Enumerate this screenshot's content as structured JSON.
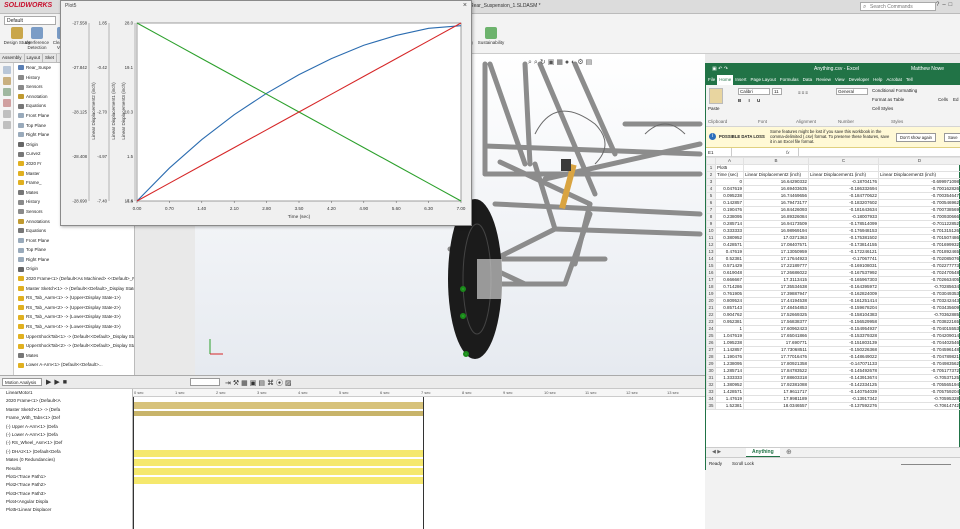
{
  "app": {
    "name": "SOLIDWORKS",
    "doc_title": "Rear_Suspension_1.SLDASM *",
    "search_placeholder": "Search Commands",
    "config": "Default"
  },
  "commands": [
    "Design Study",
    "Interference Detection",
    "Clearance Verific",
    "Hole Alignment",
    "Measure",
    "Mass Properties",
    "Costing",
    "Sustainability"
  ],
  "cm_tabs": [
    "Assembly",
    "Layout",
    "Sket"
  ],
  "tree_top": [
    {
      "label": "Rear_Suspe",
      "color": "#5a7fb5"
    },
    {
      "label": "History",
      "color": "#8a8a8a"
    },
    {
      "label": "Sensors",
      "color": "#8a8a8a"
    },
    {
      "label": "Annotation",
      "color": "#c09a30"
    },
    {
      "label": "Equations",
      "color": "#777"
    },
    {
      "label": "Front Plane",
      "color": "#9ab"
    },
    {
      "label": "Top Plane",
      "color": "#9ab"
    },
    {
      "label": "Right Plane",
      "color": "#9ab"
    },
    {
      "label": "Origin",
      "color": "#666"
    },
    {
      "label": "Curve2",
      "color": "#777"
    },
    {
      "label": "2020 Fr",
      "color": "#e0b020"
    },
    {
      "label": "Master",
      "color": "#e0b020"
    },
    {
      "label": "Frame_",
      "color": "#e0b020"
    },
    {
      "label": "Mates",
      "color": "#777"
    },
    {
      "label": "History",
      "color": "#8a8a8a"
    },
    {
      "label": "Sensors",
      "color": "#8a8a8a"
    },
    {
      "label": "Annotations",
      "color": "#c09a30"
    },
    {
      "label": "Equations",
      "color": "#777"
    },
    {
      "label": "Front Plane",
      "color": "#9ab"
    },
    {
      "label": "Top Plane",
      "color": "#9ab"
    },
    {
      "label": "Right Plane",
      "color": "#9ab"
    },
    {
      "label": "Origin",
      "color": "#666"
    },
    {
      "label": "2020 Frame<1> (Default<As Machined> <<Default>_PhotoWork",
      "color": "#e0b020"
    },
    {
      "label": "Master Sketch<1> -> (Default<<Default>_Display State 1>)",
      "color": "#e0b020"
    },
    {
      "label": "RS_Tab_Aarm<1> -> (Upper<Display State-1>)",
      "color": "#e0b020"
    },
    {
      "label": "RS_Tab_Aarm<2> -> (Upper<Display State-2>)",
      "color": "#e0b020"
    },
    {
      "label": "RS_Tab_Aarm<3> -> (Lower<Display State-3>)",
      "color": "#e0b020"
    },
    {
      "label": "RS_Tab_Aarm<4> -> (Lower<Display State-3>)",
      "color": "#e0b020"
    },
    {
      "label": "UpperShockTab<1> -> (Default<<Default>_Display State 1>)",
      "color": "#e0b020"
    },
    {
      "label": "UpperShockTab<2> -> (Default<<Default>_Display State 1>)",
      "color": "#e0b020"
    },
    {
      "label": "Mates",
      "color": "#777"
    },
    {
      "label": "Lower A-Arm<1> (Default<<Default>...",
      "color": "#e0b020"
    }
  ],
  "plot": {
    "window_title": "Plot5",
    "close": "×"
  },
  "chart_data": {
    "type": "line",
    "title": "",
    "xlabel": "Time (sec)",
    "ylabel_left1": "Linear Displacement2 (inch)",
    "ylabel_left2": "Linear Displacement1 (inch)",
    "ylabel_right": "Linear Displacement3 (inch)",
    "x": [
      0.0,
      0.7,
      1.4,
      2.1,
      2.8,
      3.5,
      4.2,
      4.9,
      5.6,
      6.3,
      7.0
    ],
    "xlim": [
      0.0,
      7.0
    ],
    "xticks": [
      "0.00",
      "0.70",
      "1.40",
      "2.10",
      "2.80",
      "3.50",
      "4.20",
      "4.90",
      "5.60",
      "6.30",
      "7.00"
    ],
    "axis1_ticks": [
      "-27.558",
      "-27.842",
      "-28.125",
      "-28.408",
      "-28.690"
    ],
    "axis2_ticks": [
      "1.85",
      "-0.42",
      "-2.70",
      "-4.97",
      "-7.40"
    ],
    "axis3_ticks": [
      "28.0",
      "19.1",
      "10.3",
      "1.5",
      "-7.4"
    ],
    "axis4_ticks": [
      "16.6"
    ],
    "ylim": [
      0,
      1
    ],
    "series": [
      {
        "color": "#2b6cb0",
        "values": [
          0.0,
          0.185,
          0.345,
          0.485,
          0.605,
          0.71,
          0.8,
          0.875,
          0.93,
          0.97,
          0.985
        ]
      },
      {
        "color": "#2ca02c",
        "values": [
          1.0,
          0.9,
          0.8,
          0.7,
          0.6,
          0.5,
          0.4,
          0.3,
          0.2,
          0.1,
          0.0
        ]
      },
      {
        "color": "#d62728",
        "values": [
          0.0,
          0.1,
          0.2,
          0.3,
          0.4,
          0.5,
          0.6,
          0.7,
          0.8,
          0.9,
          1.0
        ]
      }
    ]
  },
  "motion": {
    "study_type": "Motion Analysis",
    "items": [
      "LinearMotor1",
      "2020 Frame<1> (Default<A",
      "Master Sketch<1> -> (Defa",
      "Frame_With_Tabs<1> (Def",
      "(-) Upper A-Arm<1> (Defa",
      "(-) Lower A-Arm<1> (Defa",
      "(-) RS_Wheel_Asm<1> (Def",
      "(-) DHA2<1> (Default<Defa",
      "Mates (0 Redundancies)",
      "Results",
      "Plot1<Trace Path1>",
      "Plot2<Trace Path2>",
      "Plot3<Trace Path3>",
      "Plot4<Angular Displa",
      "Plot5<Linear Displacer"
    ],
    "ruler": [
      "0 sec",
      "1 sec",
      "2 sec",
      "3 sec",
      "4 sec",
      "5 sec",
      "6 sec",
      "7 sec",
      "8 sec",
      "9 sec",
      "10 sec",
      "11 sec",
      "12 sec",
      "13 sec",
      "14 sec"
    ],
    "hint": "Rear_Suspension_1"
  },
  "excel": {
    "title": "Anything.csv - Excel",
    "user": "Matthew Nowe",
    "tabs": [
      "File",
      "Home",
      "Insert",
      "Page Layout",
      "Formulas",
      "Data",
      "Review",
      "View",
      "Developer",
      "Help",
      "Acrobat",
      "Tell"
    ],
    "ribbon": {
      "paste": "Paste",
      "clipboard": "Clipboard",
      "font_name": "Calibri",
      "font_size": "11",
      "font_group": "Font",
      "alignment": "Alignment",
      "number_format": "General",
      "number_group": "Number",
      "cond_format": "Conditional Formatting",
      "format_table": "Format as Table",
      "cell_styles": "Cell Styles",
      "styles_group": "Styles",
      "cells": "Cells",
      "editing": "Ed"
    },
    "warning": {
      "label": "POSSIBLE DATA LOSS",
      "text": "Some features might be lost if you save this workbook in the comma-delimited (.csv) format. To preserve these features, save it in an Excel file format.",
      "btn1": "Don't show again",
      "btn2": "Save"
    },
    "cell_ref": "E1",
    "fx": "fx",
    "columns": [
      "A",
      "B",
      "C",
      "D"
    ],
    "rows": [
      [
        "Plot5",
        "",
        "",
        ""
      ],
      [
        "Time (sec)",
        "Linear Displacement2 (inch)",
        "Linear Displacement1 (inch)",
        "Linear Displacement3 (inch)"
      ],
      [
        "0",
        "16.64290332",
        "-0.18704176",
        "-0.699971098"
      ],
      [
        "0.047619",
        "16.69403635",
        "-0.186332694",
        "-0.700162826"
      ],
      [
        "0.095238",
        "16.74469656",
        "-0.184770622",
        "-0.700354647"
      ],
      [
        "0.142857",
        "16.79473177",
        "-0.183207602",
        "-0.700546962"
      ],
      [
        "0.190476",
        "16.84426093",
        "-0.181643634",
        "-0.700738569"
      ],
      [
        "0.238095",
        "16.89326084",
        "-0.18007933",
        "-0.700930666"
      ],
      [
        "0.285714",
        "16.94173509",
        "-0.178514099",
        "-0.701122852"
      ],
      [
        "0.333333",
        "16.98969194",
        "-0.176948153",
        "-0.701315126"
      ],
      [
        "0.380952",
        "17.0371363",
        "-0.175381502",
        "-0.701507486"
      ],
      [
        "0.428571",
        "17.08407571",
        "-0.173814155",
        "-0.701699932"
      ],
      [
        "0.47619",
        "17.13050959",
        "-0.172246121",
        "-0.701892465"
      ],
      [
        "0.52381",
        "17.17644923",
        "-0.17067741",
        "-0.702085076"
      ],
      [
        "0.571429",
        "17.22189777",
        "-0.169108031",
        "-0.702277773"
      ],
      [
        "0.619048",
        "17.26686022",
        "-0.167537992",
        "-0.702470548"
      ],
      [
        "0.666667",
        "17.3113415",
        "-0.165967303",
        "-0.702663405"
      ],
      [
        "0.714286",
        "17.35534638",
        "-0.164395972",
        "-0.70285634"
      ],
      [
        "0.761905",
        "17.39887947",
        "-0.162824009",
        "-0.703049353"
      ],
      [
        "0.809524",
        "17.44194538",
        "-0.161251414",
        "-0.703242443"
      ],
      [
        "0.857143",
        "17.48454853",
        "-0.159678204",
        "-0.703435609"
      ],
      [
        "0.904762",
        "17.52669325",
        "-0.158104383",
        "-0.70362885"
      ],
      [
        "0.952381",
        "17.56838377",
        "-0.156529958",
        "-0.703822165"
      ],
      [
        "1",
        "17.60962423",
        "-0.154954937",
        "-0.704015553"
      ],
      [
        "1.047619",
        "17.65041866",
        "-0.153379328",
        "-0.704209014"
      ],
      [
        "1.095238",
        "17.690771",
        "-0.151803139",
        "-0.704402546"
      ],
      [
        "1.142857",
        "17.73068511",
        "-0.150226368",
        "-0.704596148"
      ],
      [
        "1.190476",
        "17.77016476",
        "-0.148649022",
        "-0.704789821"
      ],
      [
        "1.238095",
        "17.80921358",
        "-0.147071133",
        "-0.704983562"
      ],
      [
        "1.285714",
        "17.84783522",
        "-0.145492678",
        "-0.705177372"
      ],
      [
        "1.333333",
        "17.88603318",
        "-0.143913674",
        "-0.70537125"
      ],
      [
        "1.380952",
        "17.92381088",
        "-0.142334125",
        "-0.705565194"
      ],
      [
        "1.428571",
        "17.9611717",
        "-0.140754039",
        "-0.705759204"
      ],
      [
        "1.47619",
        "17.9981189",
        "-0.13917342",
        "-0.70595328"
      ],
      [
        "1.52381",
        "18.0346557",
        "-0.137592276",
        "-0.70614742"
      ]
    ],
    "sheet": "Anything",
    "status": "Ready",
    "status2": "Scroll Lock"
  }
}
